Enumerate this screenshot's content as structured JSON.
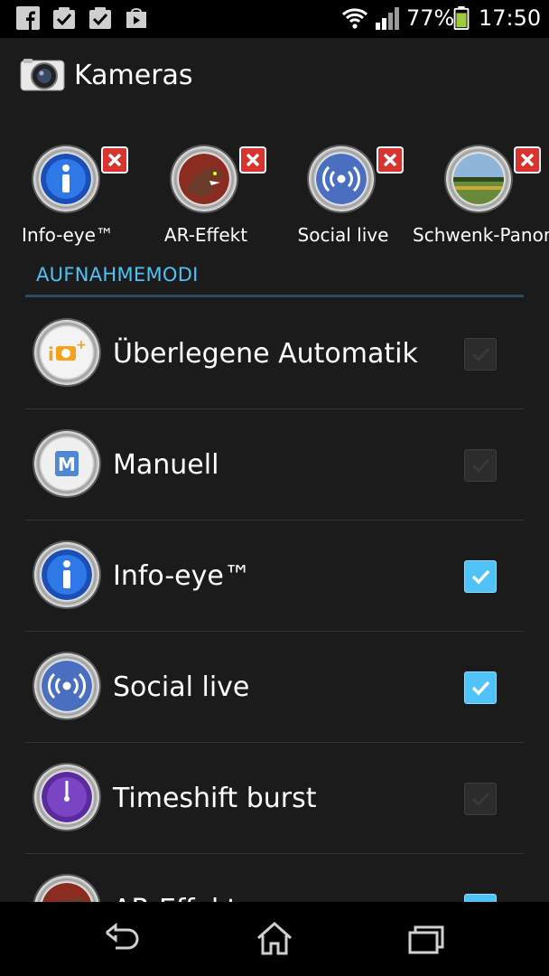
{
  "status_bar": {
    "battery_percent": "77%",
    "time": "17:50",
    "notification_icons": [
      "facebook-icon",
      "checkbox-icon",
      "checkbox-icon",
      "play-store-icon"
    ]
  },
  "action_bar": {
    "title": "Kameras",
    "icon": "camera-icon"
  },
  "selected_modes": [
    {
      "label": "Info-eye™",
      "icon": "info-eye-icon"
    },
    {
      "label": "AR-Effekt",
      "icon": "ar-effect-icon"
    },
    {
      "label": "Social live",
      "icon": "social-live-icon"
    },
    {
      "label": "Schwenk-Panora",
      "icon": "panorama-icon"
    }
  ],
  "section": {
    "title": "AUFNAHMEMODI"
  },
  "modes": [
    {
      "label": "Überlegene Automatik",
      "icon": "superior-auto-icon",
      "checked": false
    },
    {
      "label": "Manuell",
      "icon": "manual-icon",
      "checked": false
    },
    {
      "label": "Info-eye™",
      "icon": "info-eye-icon",
      "checked": true
    },
    {
      "label": "Social live",
      "icon": "social-live-icon",
      "checked": true
    },
    {
      "label": "Timeshift burst",
      "icon": "timeshift-icon",
      "checked": false
    },
    {
      "label": "AR-Effekt",
      "icon": "ar-effect-icon",
      "checked": true
    }
  ],
  "colors": {
    "accent": "#4fc3f7",
    "background": "#1b1b1b",
    "remove_red": "#d8332e"
  },
  "nav_bar": {
    "buttons": [
      "back-icon",
      "home-icon",
      "recent-apps-icon"
    ]
  }
}
